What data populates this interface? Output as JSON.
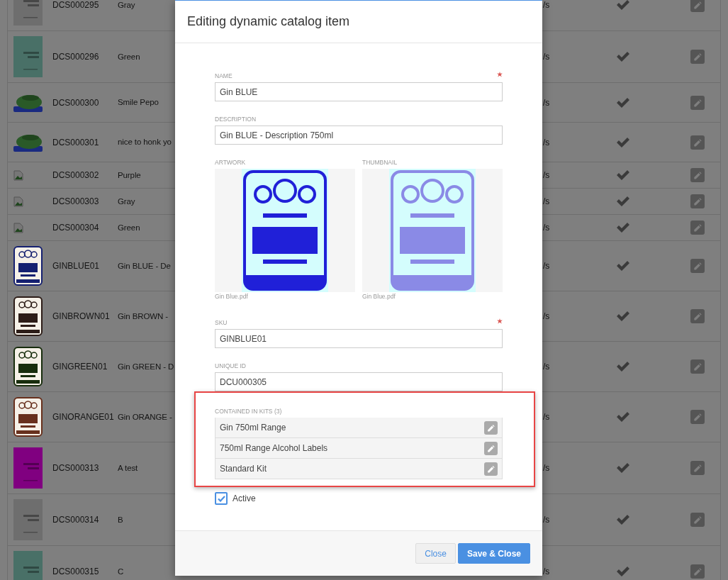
{
  "table": {
    "rows": [
      {
        "thumb": {
          "kind": "cover",
          "color": "#6e6e6e"
        },
        "code": "DCS000295",
        "name": "Gray",
        "column_4": "/s",
        "active": true
      },
      {
        "thumb": {
          "kind": "cover",
          "color": "#497067"
        },
        "code": "DCS000296",
        "name": "Green",
        "column_4": "/s",
        "active": true
      },
      {
        "thumb": {
          "kind": "figure"
        },
        "code": "DCS000300",
        "name": "Smile Pepo",
        "column_4": "/s",
        "active": true
      },
      {
        "thumb": {
          "kind": "figure"
        },
        "code": "DCS000301",
        "name": "nice to honk yo",
        "column_4": "/s",
        "active": true
      },
      {
        "thumb": {
          "kind": "broken"
        },
        "code": "DCS000302",
        "name": "Purple",
        "column_4": "/s",
        "active": true
      },
      {
        "thumb": {
          "kind": "broken"
        },
        "code": "DCS000303",
        "name": "Gray",
        "column_4": "/s",
        "active": true
      },
      {
        "thumb": {
          "kind": "broken"
        },
        "code": "DCS000304",
        "name": "Green",
        "column_4": "/s",
        "active": true
      },
      {
        "thumb": {
          "kind": "label",
          "color": "#152070"
        },
        "code": "GINBLUE01",
        "name": "Gin BLUE - De",
        "column_4": "/s",
        "active": true
      },
      {
        "thumb": {
          "kind": "label",
          "color": "#2d1d18"
        },
        "code": "GINBROWN01",
        "name": "Gin BROWN -",
        "column_4": "/s",
        "active": true
      },
      {
        "thumb": {
          "kind": "label",
          "color": "#182d0d"
        },
        "code": "GINGREEN01",
        "name": "Gin GREEN - D",
        "column_4": "/s",
        "active": true
      },
      {
        "thumb": {
          "kind": "label",
          "color": "#68301d"
        },
        "code": "GINORANGE01",
        "name": "Gin ORANGE -",
        "column_4": "/s",
        "active": true
      },
      {
        "thumb": {
          "kind": "cover",
          "color": "#800080"
        },
        "code": "DCS000313",
        "name": "A test",
        "column_4": "/s",
        "active": true
      },
      {
        "thumb": {
          "kind": "cover",
          "color": "#6e6e6e"
        },
        "code": "DCS000314",
        "name": "B",
        "column_4": "/s",
        "active": true
      },
      {
        "thumb": {
          "kind": "cover",
          "color": "#497067"
        },
        "code": "DCS000315",
        "name": "C",
        "column_4": "/s",
        "active": true
      }
    ]
  },
  "modal": {
    "title": "Editing dynamic catalog item",
    "form": [
      {
        "kind": "input",
        "label": "NAME",
        "value": "Gin BLUE",
        "required": true
      },
      {
        "kind": "input",
        "label": "DESCRIPTION",
        "value": "Gin BLUE - Description 750ml",
        "required": false
      },
      {
        "kind": "media",
        "items": [
          {
            "label": "ARTWORK",
            "file": "Gin Blue.pdf",
            "color": "#2020d8"
          },
          {
            "label": "THUMBNAIL",
            "file": "Gin Blue.pdf",
            "color": "#8a8ae6"
          }
        ]
      },
      {
        "kind": "input",
        "label": "SKU",
        "value": "GINBLUE01",
        "required": true
      },
      {
        "kind": "input",
        "label": "UNIQUE ID",
        "value": "DCU000305",
        "required": false
      }
    ],
    "kits": {
      "label": "CONTAINED IN KITS (3)",
      "highlighted": true,
      "items": [
        "Gin 750ml Range",
        "750ml Range Alcohol Labels",
        "Standard Kit"
      ]
    },
    "active": {
      "label": "Active",
      "checked": true
    },
    "buttons": [
      {
        "label": "Close",
        "kind": "secondary"
      },
      {
        "label": "Save & Close",
        "kind": "primary"
      }
    ]
  }
}
